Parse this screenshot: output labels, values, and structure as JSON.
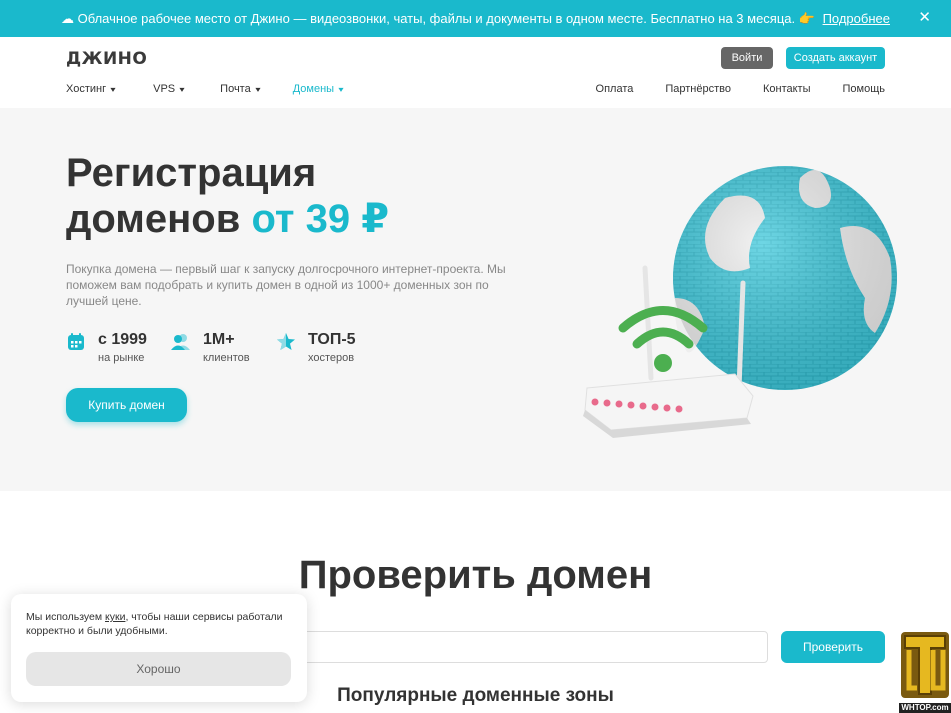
{
  "promo": {
    "icon": "cloud-icon",
    "text": "Облачное рабочее место от Джино — видеозвонки, чаты, файлы и документы в одном месте. Бесплатно на 3 месяца. 👉",
    "link": "Подробнее",
    "close": "✕"
  },
  "header": {
    "logo": "ДЖИНО",
    "login": "Войти",
    "signup": "Создать аккаунт",
    "nav_left": [
      {
        "label": "Хостинг"
      },
      {
        "label": "VPS"
      },
      {
        "label": "Почта"
      },
      {
        "label": "Домены",
        "active": true
      }
    ],
    "nav_right": [
      "Оплата",
      "Партнёрство",
      "Контакты",
      "Помощь"
    ]
  },
  "hero": {
    "title_line1": "Регистрация",
    "title_line2": "доменов",
    "title_accent": "от 39 ₽",
    "description": "Покупка домена — первый шаг к запуску долгосрочного интернет-проекта. Мы поможем вам подобрать и купить домен в одной из 1000+ доменных зон по лучшей цене.",
    "stats": [
      {
        "icon": "calendar-icon",
        "value": "с 1999",
        "label": "на рынке"
      },
      {
        "icon": "users-icon",
        "value": "1M+",
        "label": "клиентов"
      },
      {
        "icon": "star-icon",
        "value": "ТОП-5",
        "label": "хостеров"
      }
    ],
    "button": "Купить домен"
  },
  "check": {
    "title": "Проверить домен",
    "input_value": "",
    "button": "Проверить",
    "zones_title": "Популярные доменные зоны"
  },
  "cookie": {
    "text_before": "Мы используем ",
    "link": "куки",
    "text_after": ", чтобы наши сервисы работали корректно и были удобными.",
    "button": "Хорошо"
  },
  "watermark": {
    "text": "WHTOP.com"
  },
  "colors": {
    "accent": "#1ab9cc",
    "login_button": "#666666",
    "hero_bg": "#f6f6f6"
  }
}
